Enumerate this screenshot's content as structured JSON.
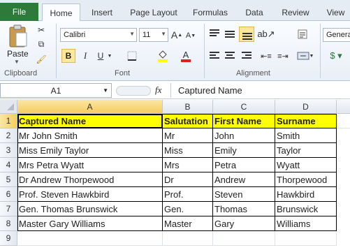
{
  "tabs": [
    {
      "label": "File"
    },
    {
      "label": "Home"
    },
    {
      "label": "Insert"
    },
    {
      "label": "Page Layout"
    },
    {
      "label": "Formulas"
    },
    {
      "label": "Data"
    },
    {
      "label": "Review"
    },
    {
      "label": "View"
    }
  ],
  "ribbon": {
    "clipboard": {
      "paste_label": "Paste",
      "group_label": "Clipboard"
    },
    "font": {
      "family": "Calibri",
      "size": "11",
      "group_label": "Font",
      "bold": "B",
      "underline": "U",
      "italic": "I",
      "grow": "A",
      "shrink": "A",
      "font_color_letter": "A"
    },
    "alignment": {
      "group_label": "Alignment"
    },
    "number": {
      "format": "Genera"
    }
  },
  "formula_bar": {
    "name_box": "A1",
    "fx": "fx",
    "content": "Captured Name"
  },
  "grid": {
    "columns": [
      "A",
      "B",
      "C",
      "D"
    ],
    "rows": [
      "1",
      "2",
      "3",
      "4",
      "5",
      "6",
      "7",
      "8",
      "9"
    ],
    "header_row": [
      "Captured Name",
      "Salutation",
      "First Name",
      "Surname"
    ],
    "data_rows": [
      [
        "Mr John Smith",
        "Mr",
        "John",
        "Smith"
      ],
      [
        "Miss Emily Taylor",
        "Miss",
        "Emily",
        "Taylor"
      ],
      [
        "Mrs Petra Wyatt",
        "Mrs",
        "Petra",
        "Wyatt"
      ],
      [
        "Dr Andrew Thorpewood",
        "Dr",
        "Andrew",
        "Thorpewood"
      ],
      [
        "Prof. Steven Hawkbird",
        "Prof.",
        "Steven",
        "Hawkbird"
      ],
      [
        "Gen. Thomas Brunswick",
        "Gen.",
        "Thomas",
        "Brunswick"
      ],
      [
        "Master Gary Williams",
        "Master",
        "Gary",
        "Williams"
      ]
    ]
  },
  "colors": {
    "file_tab": "#2e7a3a",
    "header_fill": "#ffff00",
    "selected_header": "#f5cd5d"
  }
}
